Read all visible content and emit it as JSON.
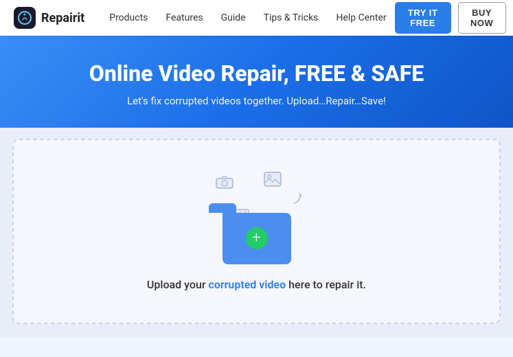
{
  "navbar": {
    "logo_text": "Repairit",
    "nav_items": [
      {
        "label": "Products"
      },
      {
        "label": "Features"
      },
      {
        "label": "Guide"
      },
      {
        "label": "Tips & Tricks"
      },
      {
        "label": "Help Center"
      }
    ],
    "try_label": "TRY IT FREE",
    "buy_label": "BUY NOW"
  },
  "hero": {
    "title": "Online Video Repair, FREE & SAFE",
    "subtitle": "Let's fix corrupted videos together. Upload…Repair…Save!"
  },
  "upload": {
    "label_pre": "Upload your ",
    "label_highlight": "corrupted video",
    "label_post": " here to repair it."
  }
}
